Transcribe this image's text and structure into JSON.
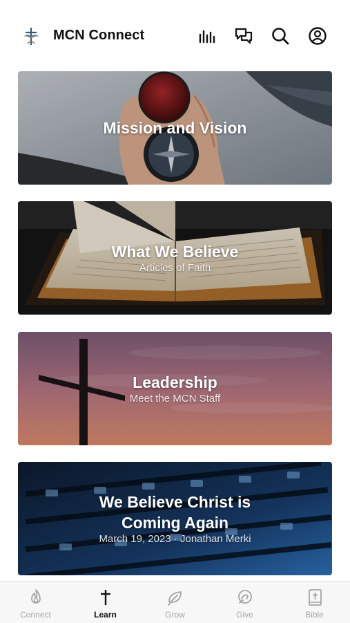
{
  "header": {
    "app_title": "MCN Connect",
    "logo_icon": "cross-dove-logo",
    "actions": [
      {
        "name": "bar-chart-icon"
      },
      {
        "name": "chat-bubbles-icon"
      },
      {
        "name": "search-icon"
      },
      {
        "name": "profile-icon"
      }
    ]
  },
  "cards": [
    {
      "title": "Mission and Vision",
      "subtitle": "",
      "image": "hand holding compass by the sea"
    },
    {
      "title": "What We Believe",
      "subtitle": "Articles of Faith",
      "image": "open bible"
    },
    {
      "title": "Leadership",
      "subtitle": "Meet the MCN Staff",
      "image": "cross silhouette at sunset"
    },
    {
      "title": "We Believe Christ is Coming Again",
      "subtitle": "March 19, 2023 · Jonathan Merki",
      "image": "audio mixing console"
    }
  ],
  "tabbar": {
    "active": "Learn",
    "tabs": [
      {
        "label": "Connect",
        "icon": "flame-icon"
      },
      {
        "label": "Learn",
        "icon": "cross-icon"
      },
      {
        "label": "Grow",
        "icon": "leaf-icon"
      },
      {
        "label": "Give",
        "icon": "give-icon"
      },
      {
        "label": "Bible",
        "icon": "bible-icon"
      }
    ]
  },
  "colors": {
    "text": "#111111",
    "tab_inactive": "#a3a3a3",
    "tab_bar_bg": "#f7f7f7"
  }
}
